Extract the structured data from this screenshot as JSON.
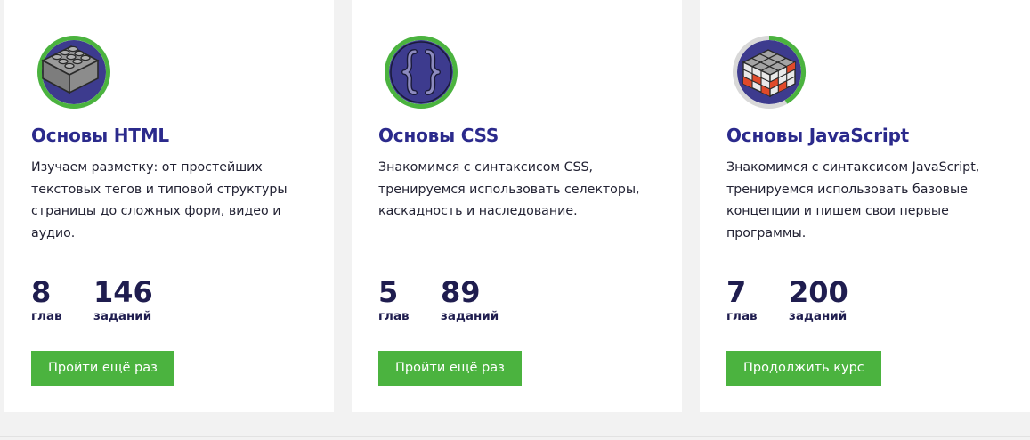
{
  "courses": [
    {
      "icon": "lego-brick-icon",
      "title": "Основы HTML",
      "description": "Изучаем разметку: от простейших текстовых тегов и типовой структуры страницы до сложных форм, видео и аудио.",
      "chapters": "8",
      "chapters_label": "глав",
      "tasks": "146",
      "tasks_label": "заданий",
      "button": "Пройти ещё раз",
      "progress": 1.0
    },
    {
      "icon": "curly-braces-icon",
      "title": "Основы CSS",
      "description": "Знакомимся с синтаксисом CSS, тренируемся использовать селекторы, каскадность и наследование.",
      "chapters": "5",
      "chapters_label": "глав",
      "tasks": "89",
      "tasks_label": "заданий",
      "button": "Пройти ещё раз",
      "progress": 1.0
    },
    {
      "icon": "rubiks-cube-icon",
      "title": "Основы JavaScript",
      "description": "Знакомимся с синтаксисом JavaScript, тренируемся использовать базовые концепции и пишем свои первые программы.",
      "chapters": "7",
      "chapters_label": "глав",
      "tasks": "200",
      "tasks_label": "заданий",
      "button": "Продолжить курс",
      "progress": 0.55
    }
  ],
  "colors": {
    "accent_green": "#4bb33f",
    "title_blue": "#2b2a8c",
    "icon_fill": "#3d3b8e",
    "numbers": "#1f1d4f"
  }
}
